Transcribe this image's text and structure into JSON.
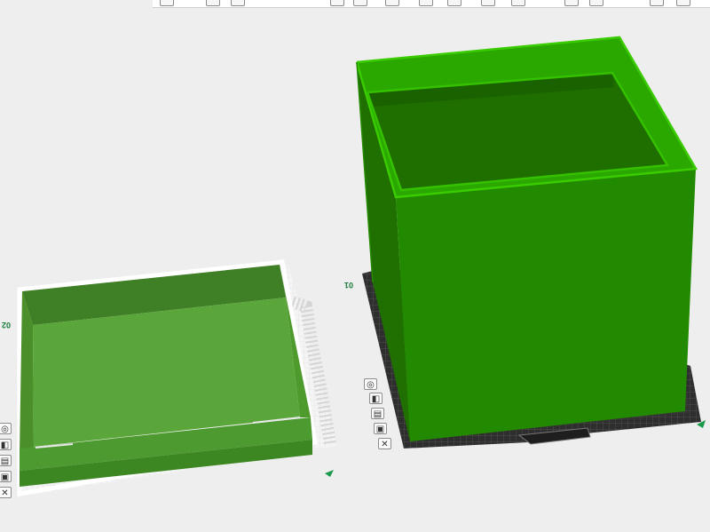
{
  "app": {
    "view": "3d-prepare-viewport"
  },
  "plates": [
    {
      "id": "plate-2",
      "label": "02"
    },
    {
      "id": "plate-1",
      "label": "01"
    }
  ],
  "plate_tools": [
    "orient-icon",
    "arrange-icon",
    "layers-icon",
    "lock-icon",
    "close-icon"
  ],
  "colors": {
    "background": "#eeeeee",
    "model_green": "#1f7400",
    "model_green_light": "#2ab000",
    "selected_green": "#3b9a1c",
    "bed_dark": "#2e2e2e"
  }
}
